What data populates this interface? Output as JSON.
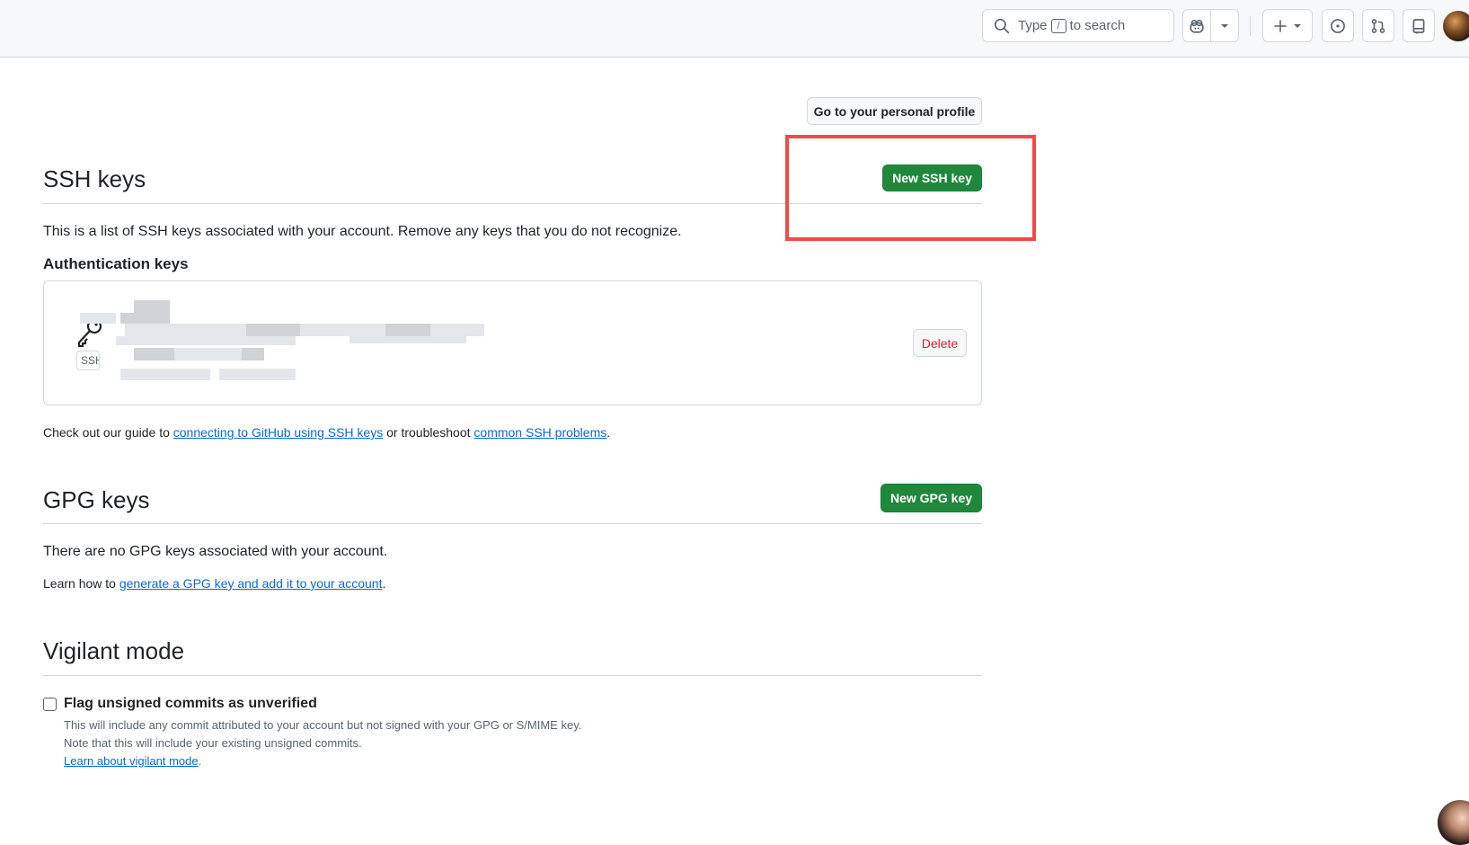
{
  "header": {
    "search": {
      "prefix": "Type",
      "kbd": "/",
      "suffix": "to search"
    },
    "icons": [
      "search-icon",
      "copilot-icon",
      "triangle-down-icon",
      "plus-icon",
      "issue-opened-icon",
      "git-pull-request-icon",
      "inbox-icon"
    ]
  },
  "profile_button": "Go to your personal profile",
  "ssh": {
    "title": "SSH keys",
    "new_button": "New SSH key",
    "description": "This is a list of SSH keys associated with your account. Remove any keys that you do not recognize.",
    "auth_heading": "Authentication keys",
    "key_badge": "SSH",
    "delete_button": "Delete",
    "guide": {
      "prefix": "Check out our guide to ",
      "link1": "connecting to GitHub using SSH keys",
      "middle": " or troubleshoot ",
      "link2": "common SSH problems",
      "suffix": "."
    }
  },
  "gpg": {
    "title": "GPG keys",
    "new_button": "New GPG key",
    "empty": "There are no GPG keys associated with your account.",
    "learn": {
      "prefix": "Learn how to ",
      "link": "generate a GPG key and add it to your account",
      "suffix": "."
    }
  },
  "vigilant": {
    "title": "Vigilant mode",
    "checkbox_label": "Flag unsigned commits as unverified",
    "checked": false,
    "note1": "This will include any commit attributed to your account but not signed with your GPG or S/MIME key.",
    "note2": "Note that this will include your existing unsigned commits.",
    "link": "Learn about vigilant mode",
    "link_suffix": "."
  },
  "colors": {
    "primary_button": "#1f883d",
    "link": "#0969da",
    "danger": "#d1242f",
    "highlight_box": "#ef4a4a"
  }
}
